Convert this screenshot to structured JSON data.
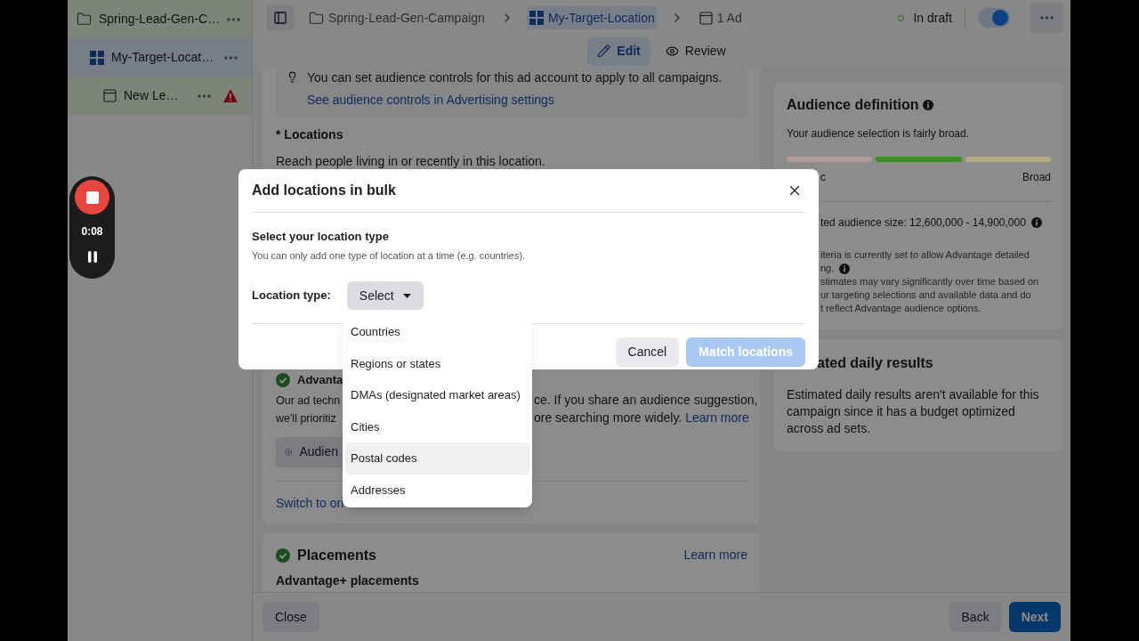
{
  "sidebar": {
    "items": [
      {
        "kind": "campaign",
        "label": "Spring-Lead-Gen-C…",
        "selected": false,
        "warning": false,
        "children": [
          {
            "kind": "adset",
            "label": "My-Target-Locat…",
            "selected": true,
            "warning": false,
            "children": [
              {
                "kind": "ad",
                "label": "New Le…",
                "selected": false,
                "warning": true
              }
            ]
          }
        ]
      }
    ]
  },
  "recorder": {
    "time": "0:08"
  },
  "breadcrumbs": [
    {
      "kind": "campaign",
      "label": "Spring-Lead-Gen-Campaign",
      "selected": false
    },
    {
      "kind": "adset",
      "label": "My-Target-Location",
      "selected": true
    },
    {
      "kind": "ad",
      "label": "1 Ad",
      "selected": false
    }
  ],
  "status": {
    "label": "In draft",
    "on": true
  },
  "tabs": [
    {
      "kind": "edit",
      "label": "Edit",
      "selected": true
    },
    {
      "kind": "review",
      "label": "Review",
      "selected": false
    }
  ],
  "main": {
    "notice": {
      "text": "You can set audience controls for this ad account to apply to all campaigns.",
      "link": "See audience controls in Advertising settings"
    },
    "locations": {
      "title": "* Locations",
      "description": "Reach people living in or recently in this location."
    },
    "advantage": {
      "title": "Advanta",
      "lines": [
        {
          "left": "Our ad techn",
          "right": "ce. If you share an audience suggestion,"
        },
        {
          "left": "we'll prioritiz",
          "right": "ore searching more widely.",
          "link": "Learn more"
        }
      ],
      "button": "Audien",
      "switch_link": "Switch to ori"
    },
    "placements": {
      "title": "Placements",
      "link": "Learn more",
      "subtitle": "Advantage+ placements"
    }
  },
  "audience_panel": {
    "title": "Audience definition",
    "summary": "Your audience selection is fairly broad.",
    "meter": [
      {
        "color": "#b39a9a"
      },
      {
        "color": "#3c8f26"
      },
      {
        "color": "#b3aa86"
      }
    ],
    "left_label": "c",
    "right_label": "Broad",
    "size": "ted audience size: 12,600,000 - 14,900,000",
    "notes": [
      {
        "text": "iteria is currently set to allow Advantage detailed",
        "info": false
      },
      {
        "text": "ng.",
        "info": true
      },
      {
        "text": "stimates may vary significantly over time based on",
        "info": false
      },
      {
        "text": "ur targeting selections and available data and do",
        "info": false
      },
      {
        "text": "t reflect Advantage audience options.",
        "info": false
      }
    ]
  },
  "daily_results": {
    "title": "ated daily results",
    "text": "Estimated daily results aren't available for this campaign since it has a budget optimized across ad sets."
  },
  "footer": {
    "close": "Close",
    "back": "Back",
    "next": "Next"
  },
  "modal": {
    "title": "Add locations in bulk",
    "heading": "Select your location type",
    "hint": "You can only add one type of location at a time (e.g. countries).",
    "field_label": "Location type:",
    "select": "Select",
    "cancel": "Cancel",
    "submit": "Match locations",
    "submit_disabled": true
  },
  "dropdown": {
    "options": [
      {
        "label": "Countries",
        "highlighted": false
      },
      {
        "label": "Regions or states",
        "highlighted": false
      },
      {
        "label": "DMAs (designated market areas)",
        "highlighted": false
      },
      {
        "label": "Cities",
        "highlighted": false
      },
      {
        "label": "Postal codes",
        "highlighted": true
      },
      {
        "label": "Addresses",
        "highlighted": false
      }
    ]
  }
}
